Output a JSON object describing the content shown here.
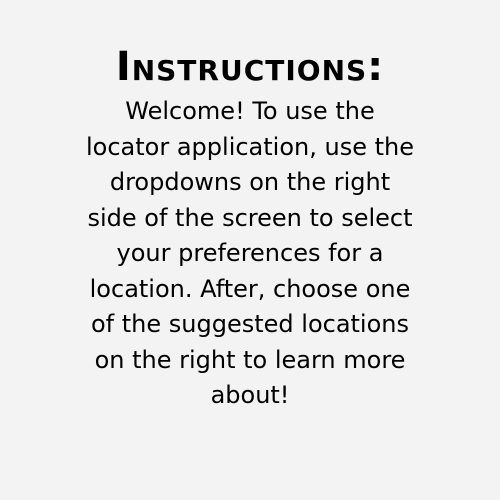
{
  "title": "Instructions:",
  "lines": [
    "Welcome! To use the",
    "locator application, use the",
    "dropdowns on the right",
    "side of the screen to select",
    "your preferences for a",
    "location. After, choose one",
    "of the suggested locations",
    "on the right to learn more",
    "about!"
  ],
  "colors": {
    "background": "#f3f3f3",
    "text": "#000000"
  }
}
